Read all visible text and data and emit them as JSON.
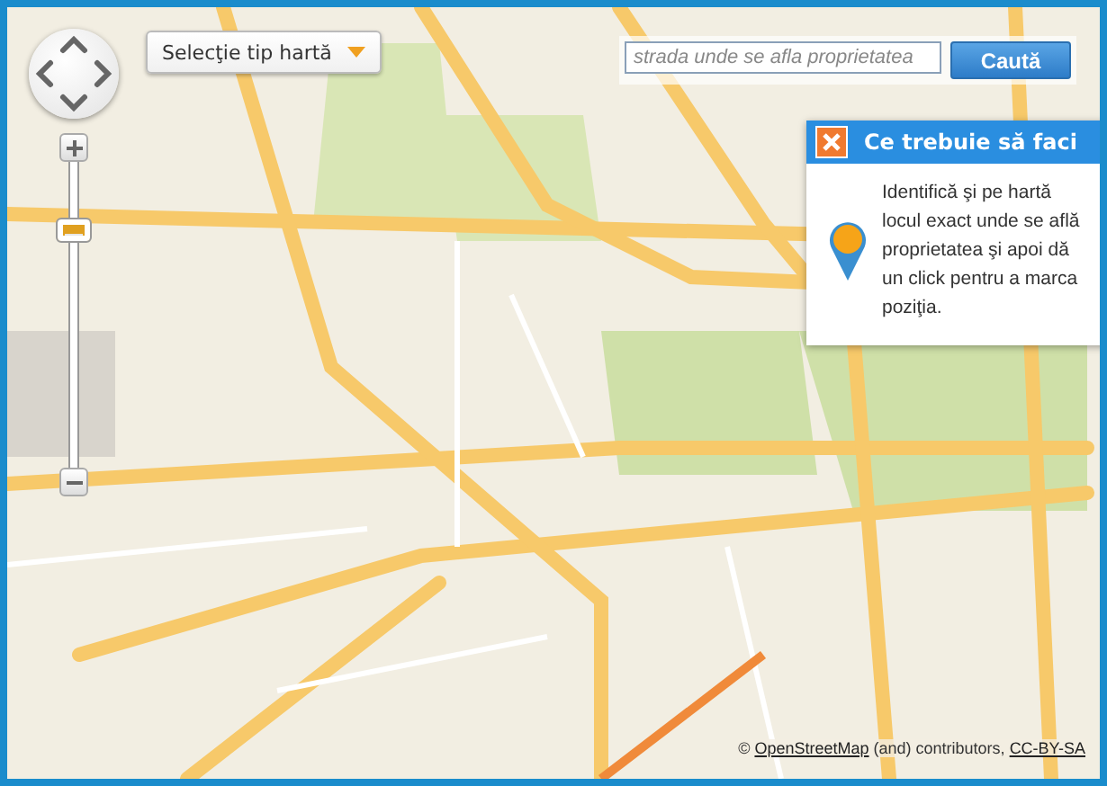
{
  "map_type_dropdown": {
    "label": "Selecţie tip hartă"
  },
  "zoom": {
    "level": 0.8
  },
  "search": {
    "placeholder": "strada unde se afla proprietatea",
    "button": "Caută"
  },
  "info_panel": {
    "title": "Ce trebuie să faci",
    "text": "Identifică şi pe hartă locul exact unde se află proprietatea şi apoi dă un click pentru a marca poziţia."
  },
  "attribution": {
    "prefix": "©",
    "link": "OpenStreetMap",
    "middle": "(and) contributors,",
    "license": "CC-BY-SA"
  }
}
